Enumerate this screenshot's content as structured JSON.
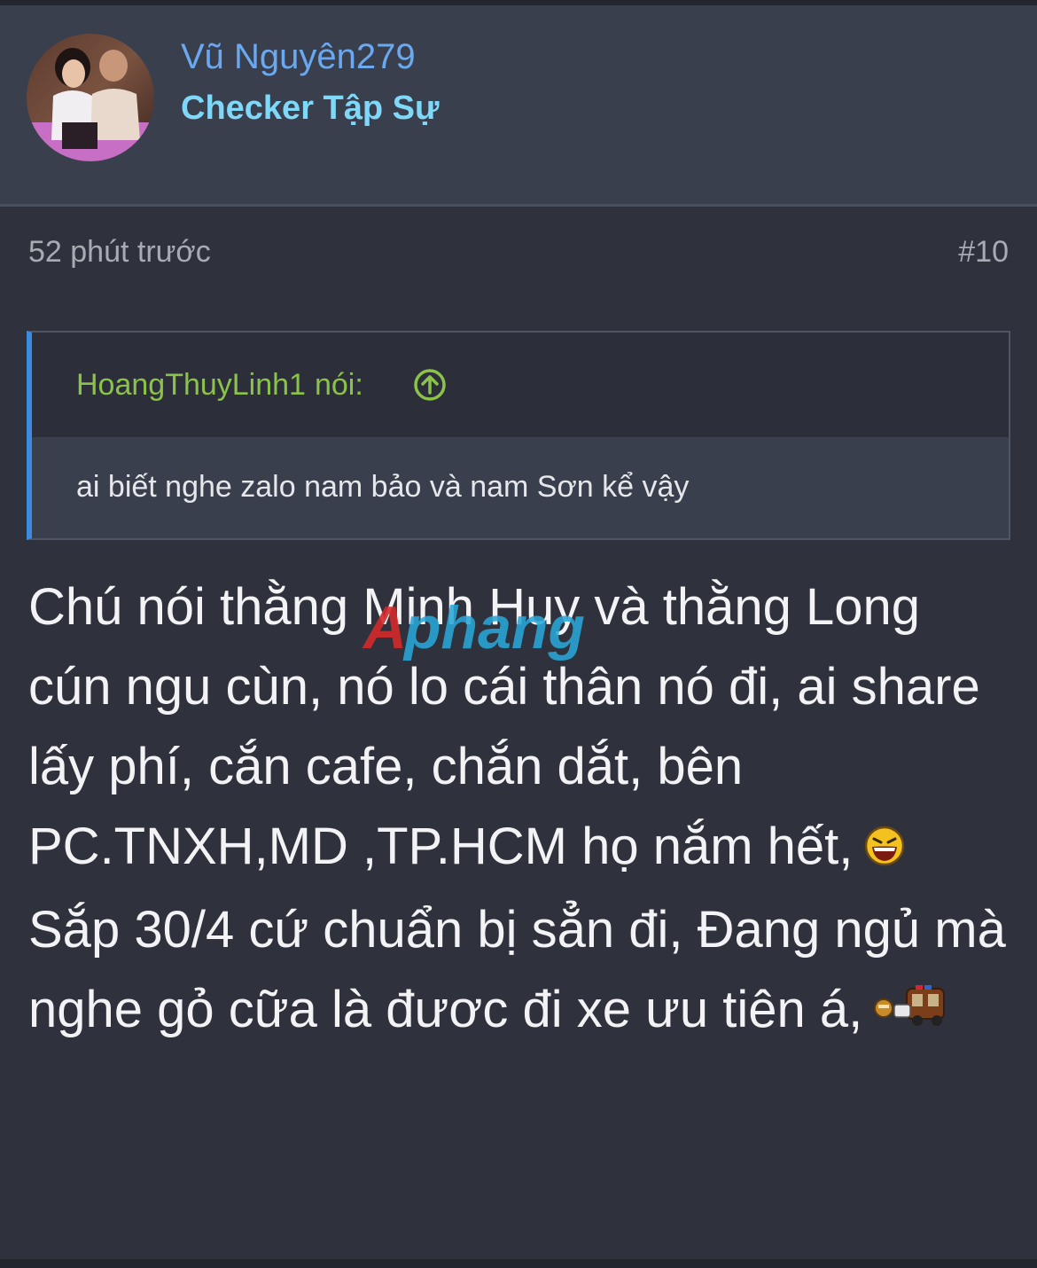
{
  "post": {
    "author": {
      "username": "Vũ Nguyên279",
      "title": "Checker Tập Sự",
      "avatar": "avatar-photo"
    },
    "time": "52 phút trước",
    "number": "#10",
    "quote": {
      "author": "HoangThuyLinh1",
      "said_label": "nói:",
      "jump_icon": "arrow-up-circle-icon",
      "text": "ai biết nghe zalo nam bảo và nam Sơn kể vậy"
    },
    "message": {
      "paragraph1": "Chú nói thằng Minh Huy và thằng Long cún ngu cùn, nó lo cái thân nó đi, ai share lấy phí, cắn cafe, chắn dắt, bên PC.TNXH,MD ,TP.HCM họ nắm hết,",
      "smilie1": "laughing-smilie",
      "paragraph2": "Sắp 30/4 cứ chuẩn bị sẳn đi, Đang ngủ mà nghe gỏ cữa là đươc đi xe ưu tiên á,",
      "smilie2": "police-van-smilie"
    },
    "watermark": "Aphang"
  },
  "colors": {
    "page_bg": "#2f323d",
    "header_bg": "#3a3f4e",
    "username": "#6aa9f0",
    "user_title": "#7fd8f8",
    "quote_author": "#8bc34a",
    "quote_border": "#3d8be0",
    "message_text": "#f3f3f5"
  }
}
